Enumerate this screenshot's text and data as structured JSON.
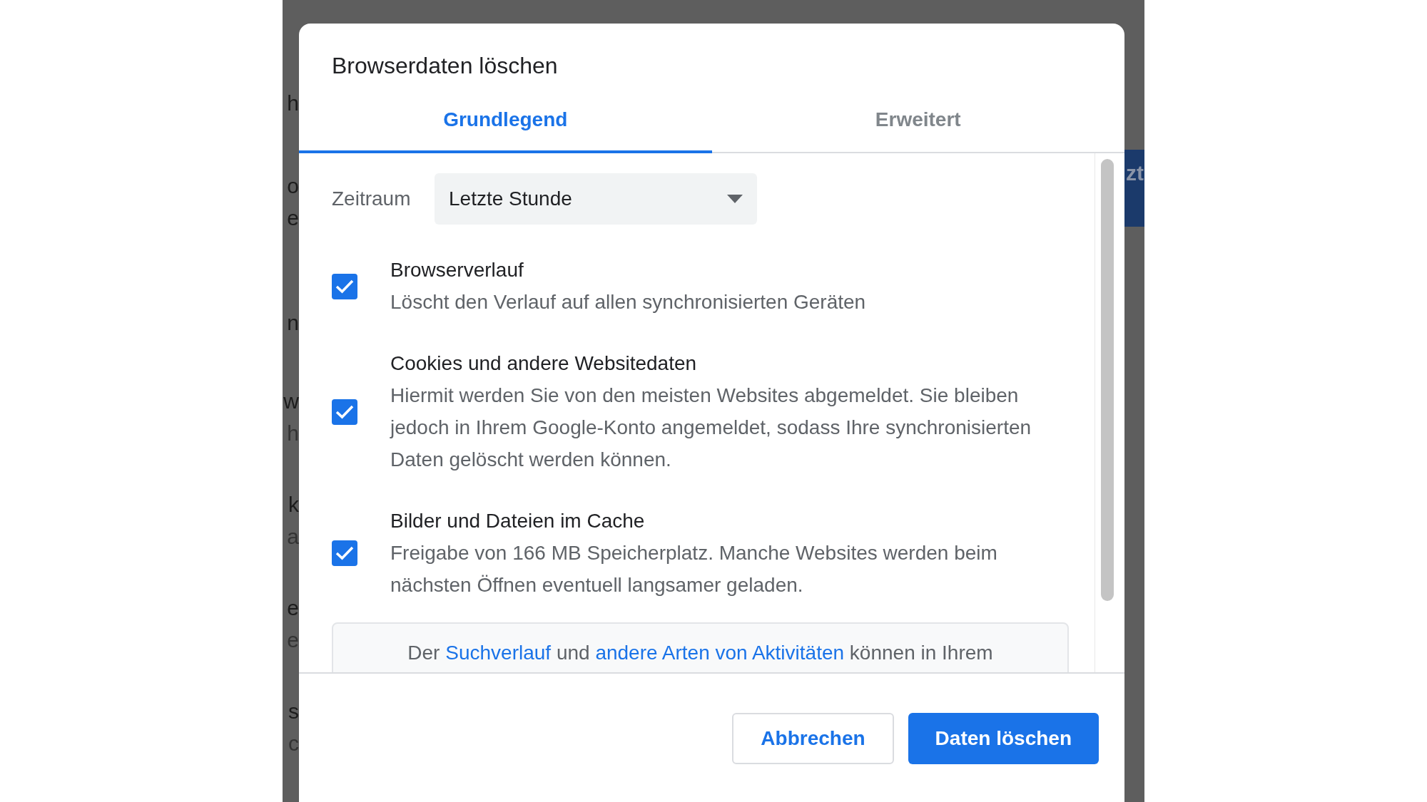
{
  "background_page": {
    "left_fragments": [
      {
        "text": "h"
      },
      {
        "text": "o"
      },
      {
        "text": "e"
      },
      {
        "text": "n"
      },
      {
        "text": "w"
      },
      {
        "text": "h"
      },
      {
        "text": "k"
      },
      {
        "text": "a"
      },
      {
        "text": "e"
      },
      {
        "text": "e"
      },
      {
        "text": "s"
      },
      {
        "text": "c"
      }
    ],
    "right_button_fragment": "zt"
  },
  "dialog": {
    "title": "Browserdaten löschen",
    "tabs": [
      {
        "label": "Grundlegend",
        "selected": true
      },
      {
        "label": "Erweitert",
        "selected": false
      }
    ],
    "time_range": {
      "label": "Zeitraum",
      "value": "Letzte Stunde"
    },
    "options": [
      {
        "title": "Browserverlauf",
        "description": "Löscht den Verlauf auf allen synchronisierten Geräten",
        "checked": true
      },
      {
        "title": "Cookies und andere Websitedaten",
        "description": "Hiermit werden Sie von den meisten Websites abgemeldet. Sie bleiben jedoch in Ihrem Google-Konto angemeldet, sodass Ihre synchronisierten Daten gelöscht werden können.",
        "checked": true
      },
      {
        "title": "Bilder und Dateien im Cache",
        "description": "Freigabe von 166 MB Speicherplatz. Manche Websites werden beim nächsten Öffnen eventuell langsamer geladen.",
        "checked": true
      }
    ],
    "info": [
      {
        "kind": "text",
        "text": "Der"
      },
      {
        "kind": "link",
        "text": "Suchverlauf"
      },
      {
        "kind": "text",
        "text": "und"
      },
      {
        "kind": "link",
        "text": "andere Arten von Aktivitäten"
      },
      {
        "kind": "text",
        "text": "können in Ihrem"
      }
    ],
    "buttons": [
      {
        "label": "Abbrechen",
        "kind": "secondary"
      },
      {
        "label": "Daten löschen",
        "kind": "primary"
      }
    ]
  }
}
